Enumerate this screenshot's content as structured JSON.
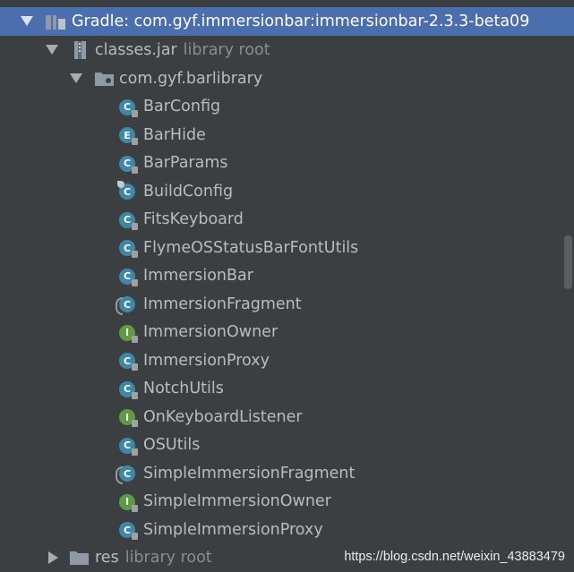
{
  "tree": {
    "gradle": {
      "label": "Gradle: com.gyf.immersionbar:immersionbar-2.3.3-beta09"
    },
    "jar": {
      "label": "classes.jar",
      "sub": "library root"
    },
    "package": {
      "label": "com.gyf.barlibrary"
    },
    "classes": [
      {
        "name": "BarConfig",
        "kind": "C",
        "modifier": "lock"
      },
      {
        "name": "BarHide",
        "kind": "E",
        "modifier": "lock"
      },
      {
        "name": "BarParams",
        "kind": "C",
        "modifier": "lock"
      },
      {
        "name": "BuildConfig",
        "kind": "C",
        "modifier": "tag"
      },
      {
        "name": "FitsKeyboard",
        "kind": "C",
        "modifier": "lock"
      },
      {
        "name": "FlymeOSStatusBarFontUtils",
        "kind": "C",
        "modifier": "lock"
      },
      {
        "name": "ImmersionBar",
        "kind": "C",
        "modifier": "lock"
      },
      {
        "name": "ImmersionFragment",
        "kind": "C",
        "modifier": "abstract"
      },
      {
        "name": "ImmersionOwner",
        "kind": "I",
        "modifier": "lock"
      },
      {
        "name": "ImmersionProxy",
        "kind": "C",
        "modifier": "lock"
      },
      {
        "name": "NotchUtils",
        "kind": "C",
        "modifier": "lock"
      },
      {
        "name": "OnKeyboardListener",
        "kind": "I",
        "modifier": "lock"
      },
      {
        "name": "OSUtils",
        "kind": "C",
        "modifier": "lock"
      },
      {
        "name": "SimpleImmersionFragment",
        "kind": "C",
        "modifier": "abstract"
      },
      {
        "name": "SimpleImmersionOwner",
        "kind": "I",
        "modifier": "lock"
      },
      {
        "name": "SimpleImmersionProxy",
        "kind": "C",
        "modifier": "lock"
      }
    ],
    "res": {
      "label": "res",
      "sub": "library root"
    }
  },
  "watermark": "https://blog.csdn.net/weixin_43883479",
  "colors": {
    "background": "#3c3f41",
    "selection": "#4b6eaf",
    "class_icon": "#3e88a7",
    "interface_icon": "#5d9c43"
  }
}
